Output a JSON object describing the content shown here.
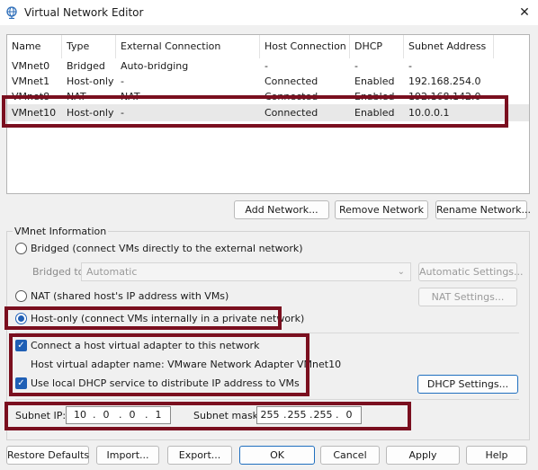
{
  "window": {
    "title": "Virtual Network Editor",
    "app_icon": "network-globe-icon",
    "close_glyph": "✕"
  },
  "table": {
    "columns": [
      "Name",
      "Type",
      "External Connection",
      "Host Connection",
      "DHCP",
      "Subnet Address"
    ],
    "rows": [
      [
        "VMnet0",
        "Bridged",
        "Auto-bridging",
        "-",
        "-",
        "-"
      ],
      [
        "VMnet1",
        "Host-only",
        "-",
        "Connected",
        "Enabled",
        "192.168.254.0"
      ],
      [
        "VMnet8",
        "NAT",
        "NAT",
        "Connected",
        "Enabled",
        "192.168.142.0"
      ],
      [
        "VMnet10",
        "Host-only",
        "-",
        "Connected",
        "Enabled",
        "10.0.0.1"
      ]
    ],
    "selected_row": 3
  },
  "table_buttons": {
    "add": "Add Network...",
    "remove": "Remove Network",
    "rename": "Rename Network..."
  },
  "vmnet_info": {
    "group_title": "VMnet Information",
    "bridged_label": "Bridged (connect VMs directly to the external network)",
    "bridged_to_label": "Bridged to:",
    "bridged_to_value": "Automatic",
    "automatic_settings": "Automatic Settings...",
    "nat_label": "NAT (shared host's IP address with VMs)",
    "nat_settings": "NAT Settings...",
    "hostonly_label": "Host-only (connect VMs internally in a private network)",
    "selected_mode": "Host-only",
    "connect_adapter_label": "Connect a host virtual adapter to this network",
    "connect_adapter_checked": true,
    "adapter_name_label": "Host virtual adapter name: VMware Network Adapter VMnet10",
    "dhcp_label": "Use local DHCP service to distribute IP address to VMs",
    "dhcp_checked": true,
    "dhcp_settings": "DHCP Settings...",
    "subnet_ip_label": "Subnet IP:",
    "subnet_ip": [
      "10",
      "0",
      "0",
      "1"
    ],
    "subnet_mask_label": "Subnet mask:",
    "subnet_mask": [
      "255",
      "255",
      "255",
      "0"
    ]
  },
  "footer": {
    "restore": "Restore Defaults",
    "import": "Import...",
    "export": "Export...",
    "ok": "OK",
    "cancel": "Cancel",
    "apply": "Apply",
    "help": "Help"
  },
  "colors": {
    "highlight": "#7a0f1f",
    "accent": "#1f5fb5"
  }
}
